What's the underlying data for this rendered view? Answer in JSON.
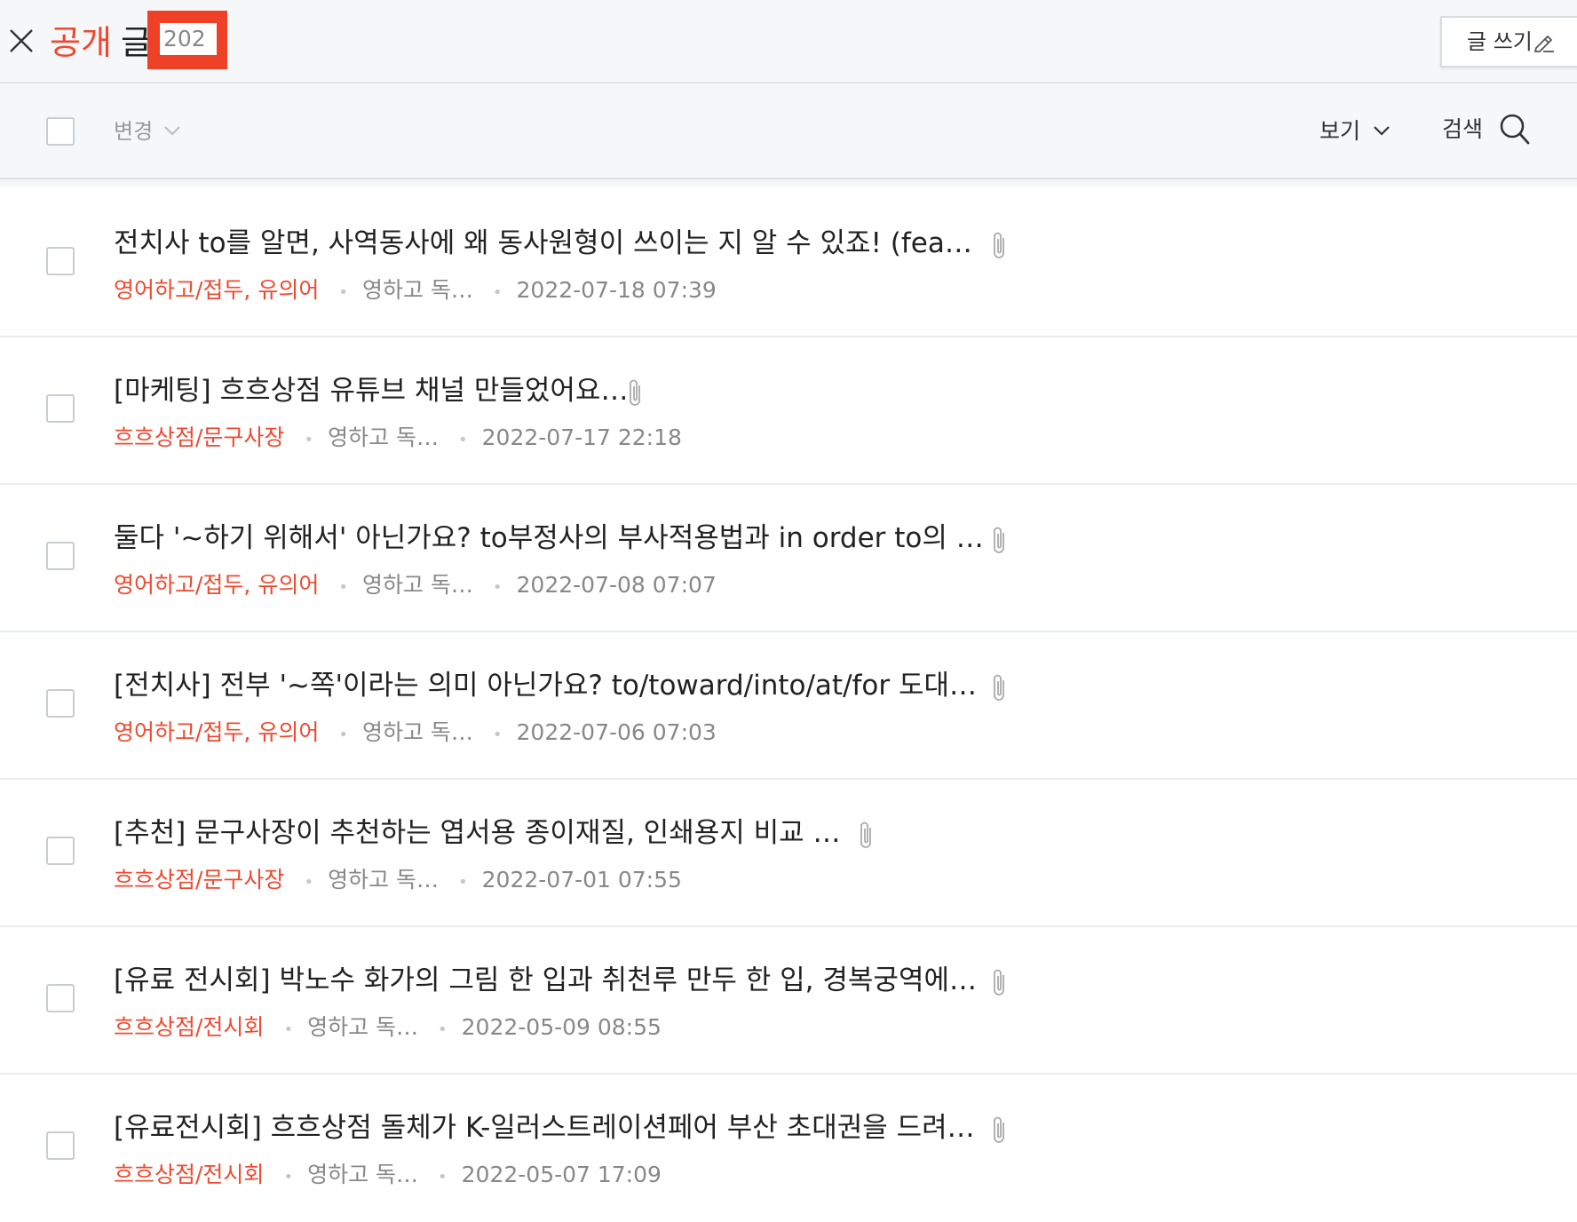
{
  "header": {
    "title_accent": "공개",
    "title_rest": "글",
    "count": "202",
    "write_label": "글 쓰기"
  },
  "toolbar": {
    "change_label": "변경",
    "view_label": "보기",
    "search_label": "검색"
  },
  "posts": [
    {
      "title": "전치사 to를 알면, 사역동사에 왜 동사원형이 쓰이는 지 알 수 있죠! (feat. …",
      "category": "영어하고/접두, 유의어",
      "author": "영하고 독…",
      "date": "2022-07-18 07:39"
    },
    {
      "title": "[마케팅] 흐흐상점 유튜브 채널 만들었어요~!",
      "category": "흐흐상점/문구사장",
      "author": "영하고 독…",
      "date": "2022-07-17 22:18"
    },
    {
      "title": "둘다 '~하기 위해서' 아닌가요? to부정사의 부사적용법과 in order to의 차…",
      "category": "영어하고/접두, 유의어",
      "author": "영하고 독…",
      "date": "2022-07-08 07:07"
    },
    {
      "title": "[전치사] 전부 '~쪽'이라는 의미 아닌가요? to/toward/into/at/for 도대체…",
      "category": "영어하고/접두, 유의어",
      "author": "영하고 독…",
      "date": "2022-07-06 07:03"
    },
    {
      "title": "[추천] 문구사장이 추천하는 엽서용 종이재질, 인쇄용지 비교 후기",
      "category": "흐흐상점/문구사장",
      "author": "영하고 독…",
      "date": "2022-07-01 07:55"
    },
    {
      "title": "[유료 전시회] 박노수 화가의 그림 한 입과 취천루 만두 한 입, 경복궁역에서…",
      "category": "흐흐상점/전시회",
      "author": "영하고 독…",
      "date": "2022-05-09 08:55"
    },
    {
      "title": "[유료전시회] 흐흐상점 돌체가 K-일러스트레이션페어 부산 초대권을 드려…",
      "category": "흐흐상점/전시회",
      "author": "영하고 독…",
      "date": "2022-05-07 17:09"
    }
  ],
  "icons": {
    "close": "close-icon",
    "pencil": "pencil-icon",
    "chevron": "chevron-down-icon",
    "search": "search-icon",
    "attachment": "paperclip-icon"
  },
  "colors": {
    "accent": "#f0492f",
    "highlight_box": "#ef4128",
    "meta_gray": "#888888"
  }
}
